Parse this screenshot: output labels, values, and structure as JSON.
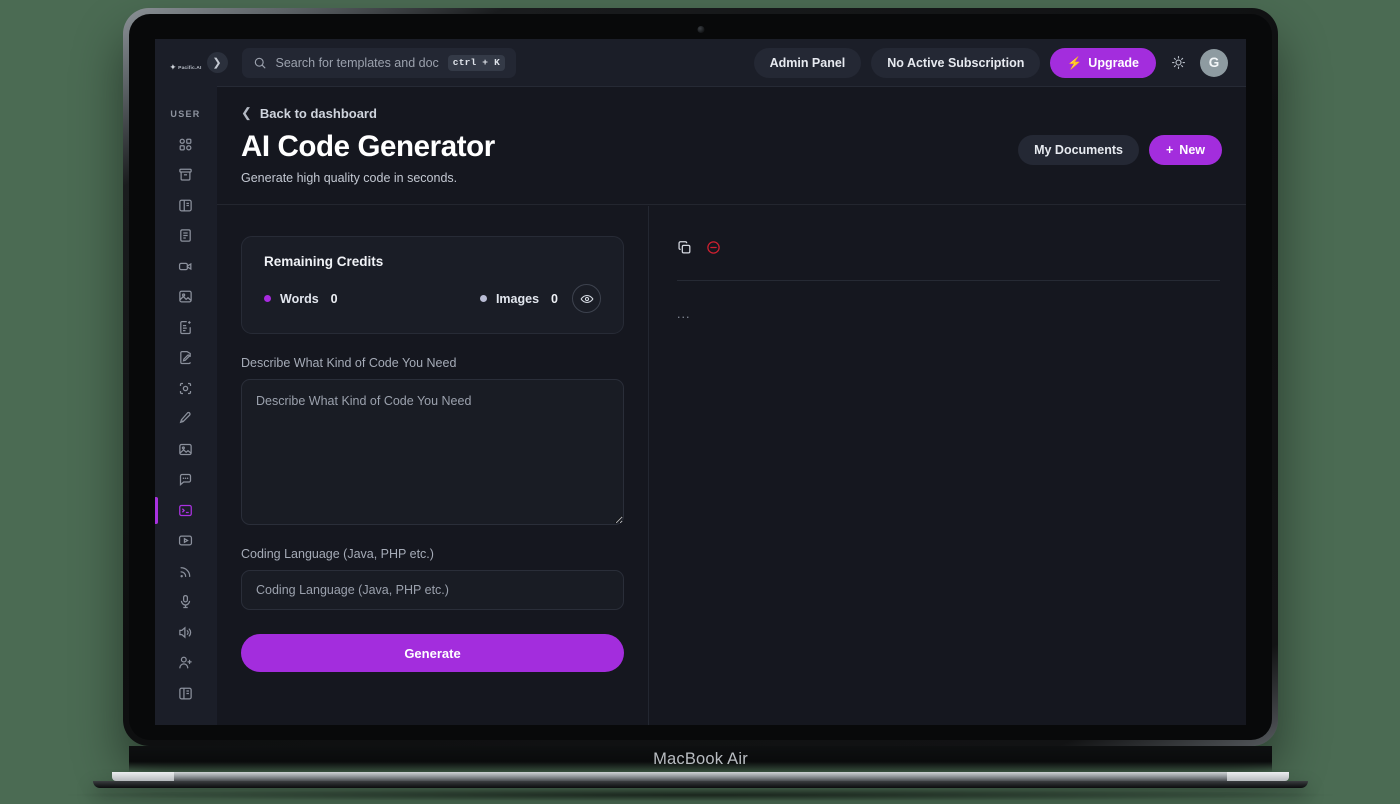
{
  "device": {
    "label": "MacBook Air"
  },
  "sidebar": {
    "brand": {
      "name": "Pacific.AI",
      "glyph_icon": "sparkle-icon"
    },
    "section_label": "USER",
    "items": [
      {
        "name": "dashboard",
        "icon": "grid-icon",
        "active": false
      },
      {
        "name": "archive",
        "icon": "archive-box-icon",
        "active": false
      },
      {
        "name": "templates",
        "icon": "panel-layout-icon",
        "active": false
      },
      {
        "name": "documents",
        "icon": "document-icon",
        "active": false
      },
      {
        "name": "video",
        "icon": "video-camera-icon",
        "active": false
      },
      {
        "name": "images",
        "icon": "image-icon",
        "active": false
      },
      {
        "name": "ai-writer",
        "icon": "file-sparkle-icon",
        "active": false
      },
      {
        "name": "editor",
        "icon": "file-pen-icon",
        "active": false
      },
      {
        "name": "vision",
        "icon": "scan-focus-icon",
        "active": false
      },
      {
        "name": "art-tools",
        "icon": "pen-tool-icon",
        "active": false
      },
      {
        "name": "photo-studio",
        "icon": "image-frame-icon",
        "active": false
      },
      {
        "name": "chat",
        "icon": "chat-bubble-icon",
        "active": false
      },
      {
        "name": "code-generator",
        "icon": "terminal-icon",
        "active": true
      },
      {
        "name": "video-player",
        "icon": "play-box-icon",
        "active": false
      },
      {
        "name": "broadcast",
        "icon": "rss-icon",
        "active": false
      },
      {
        "name": "voiceover",
        "icon": "microphone-icon",
        "active": false
      },
      {
        "name": "text-to-speech",
        "icon": "speaker-icon",
        "active": false
      },
      {
        "name": "invite-user",
        "icon": "user-plus-icon",
        "active": false
      },
      {
        "name": "brand-kit",
        "icon": "id-card-icon",
        "active": false
      }
    ]
  },
  "topbar": {
    "toggle_icon": "chevron-right-icon",
    "search": {
      "icon": "search-icon",
      "placeholder": "Search for templates and doc",
      "value": "",
      "shortcut": "ctrl + K"
    },
    "admin_panel_label": "Admin Panel",
    "subscription_label": "No Active Subscription",
    "upgrade_label": "Upgrade",
    "upgrade_icon": "bolt-icon",
    "upgrade_color": "#a32ddd",
    "theme_icon": "sun-icon",
    "avatar_initial": "G"
  },
  "page": {
    "back_label": "Back to dashboard",
    "back_icon": "chevron-left-icon",
    "title": "AI Code Generator",
    "subtitle": "Generate high quality code in seconds.",
    "my_documents_label": "My Documents",
    "new_label": "New",
    "new_icon": "plus-icon"
  },
  "credits": {
    "title": "Remaining Credits",
    "words_label": "Words",
    "words_value": "0",
    "words_color": "#a82ae0",
    "images_label": "Images",
    "images_value": "0",
    "images_color": "#b9bcd4",
    "eye_icon": "eye-icon"
  },
  "form": {
    "prompt": {
      "label": "Describe What Kind of Code You Need",
      "placeholder": "Describe What Kind of Code You Need",
      "value": ""
    },
    "language": {
      "label": "Coding Language (Java, PHP etc.)",
      "placeholder": "Coding Language (Java, PHP etc.)",
      "value": ""
    },
    "generate_label": "Generate",
    "generate_color": "#a32ddd"
  },
  "output": {
    "copy_icon": "copy-icon",
    "delete_icon": "minus-circle-icon",
    "delete_color": "#cf2030",
    "body_text": "..."
  }
}
